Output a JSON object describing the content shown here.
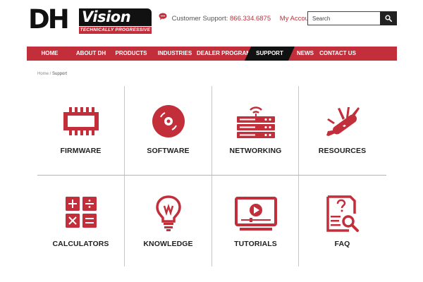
{
  "brand": {
    "logo_dh": "DH",
    "logo_vision": "Vision",
    "tagline": "TECHNICALLY PROGRESSIVE"
  },
  "header": {
    "support_label": "Customer Support: ",
    "support_phone": "866.334.6875",
    "my_account": "My Account",
    "search_placeholder": "Search"
  },
  "nav": {
    "items": [
      {
        "label": "HOME"
      },
      {
        "label": "ABOUT DH"
      },
      {
        "label": "PRODUCTS"
      },
      {
        "label": "INDUSTRIES"
      },
      {
        "label": "DEALER PROGRAM"
      },
      {
        "label": "SUPPORT",
        "active": true
      },
      {
        "label": "NEWS"
      },
      {
        "label": "CONTACT US"
      }
    ]
  },
  "breadcrumb": {
    "home": "Home",
    "separator": " / ",
    "current": "Support"
  },
  "support_tiles": [
    {
      "label": "FIRMWARE",
      "icon": "chip-icon"
    },
    {
      "label": "SOFTWARE",
      "icon": "disc-icon"
    },
    {
      "label": "NETWORKING",
      "icon": "router-icon"
    },
    {
      "label": "RESOURCES",
      "icon": "multitool-icon"
    },
    {
      "label": "CALCULATORS",
      "icon": "calculator-icon"
    },
    {
      "label": "KNOWLEDGE",
      "icon": "lightbulb-icon"
    },
    {
      "label": "TUTORIALS",
      "icon": "video-player-icon"
    },
    {
      "label": "FAQ",
      "icon": "faq-document-icon"
    }
  ],
  "colors": {
    "brand_red": "#c22f3b",
    "nav_active": "#111111",
    "text_dark": "#1f1f1f"
  }
}
